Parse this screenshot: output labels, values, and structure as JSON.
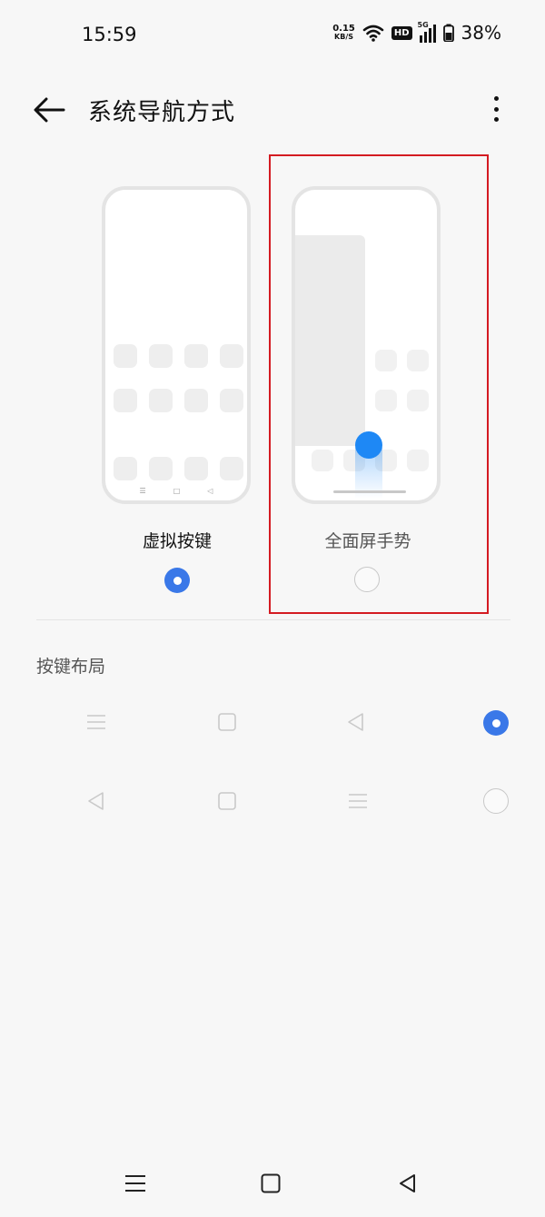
{
  "status_bar": {
    "time": "15:59",
    "net_speed_value": "0.15",
    "net_speed_unit": "KB/S",
    "hd_badge": "HD",
    "signal_label": "5G",
    "battery_percent": "38%"
  },
  "header": {
    "title": "系统导航方式"
  },
  "nav_options": [
    {
      "label": "虚拟按键",
      "selected": true
    },
    {
      "label": "全面屏手势",
      "selected": false
    }
  ],
  "button_layout": {
    "section_title": "按键布局",
    "options": [
      {
        "order": [
          "menu-icon",
          "square-icon",
          "back-triangle-icon"
        ],
        "selected": true
      },
      {
        "order": [
          "back-triangle-icon",
          "square-icon",
          "menu-icon"
        ],
        "selected": false
      }
    ]
  },
  "colors": {
    "accent": "#3a78e8",
    "gesture_dot": "#1e88f5",
    "highlight_border": "#d41b22",
    "background": "#f7f7f7"
  }
}
